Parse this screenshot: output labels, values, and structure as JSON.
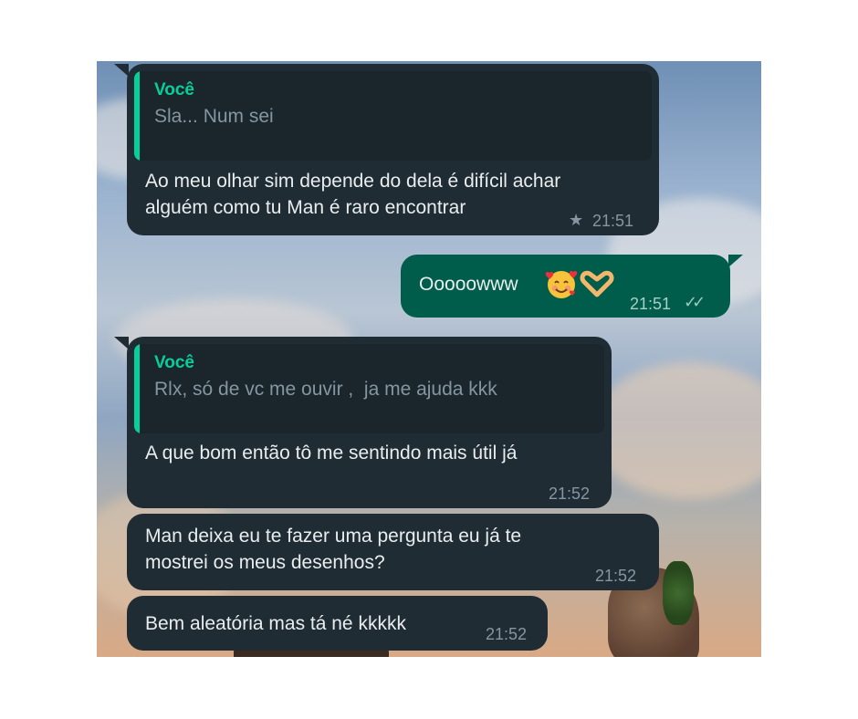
{
  "conversation": {
    "messages": [
      {
        "direction": "incoming",
        "reply": {
          "author": "Você",
          "text": "Sla... Num sei"
        },
        "text_lines": [
          "Ao meu olhar sim depende do dela é difícil achar",
          "alguém como tu Man é raro encontrar"
        ],
        "time": "21:51",
        "starred": true
      },
      {
        "direction": "outgoing",
        "text": "Ooooowww",
        "emoji": [
          "smiling-face-with-hearts-icon",
          "heart-hands-icon"
        ],
        "time": "21:51",
        "status": "read"
      },
      {
        "direction": "incoming",
        "reply": {
          "author": "Você",
          "text": "Rlx, só de vc me ouvir ,  ja me ajuda kkk"
        },
        "text_lines": [
          "A que bom então tô me sentindo mais útil já"
        ],
        "time": "21:52"
      },
      {
        "direction": "incoming",
        "text_lines": [
          "Man deixa eu te fazer uma pergunta eu já te",
          "mostrei os meus desenhos?"
        ],
        "time": "21:52"
      },
      {
        "direction": "incoming",
        "text_lines": [
          "Bem aleatória mas tá né kkkkk"
        ],
        "time": "21:52"
      }
    ]
  },
  "colors": {
    "incoming_bubble": "#1f2c34",
    "outgoing_bubble": "#005c4b",
    "quote_accent": "#06cf9c",
    "meta_text": "#8696a0"
  }
}
